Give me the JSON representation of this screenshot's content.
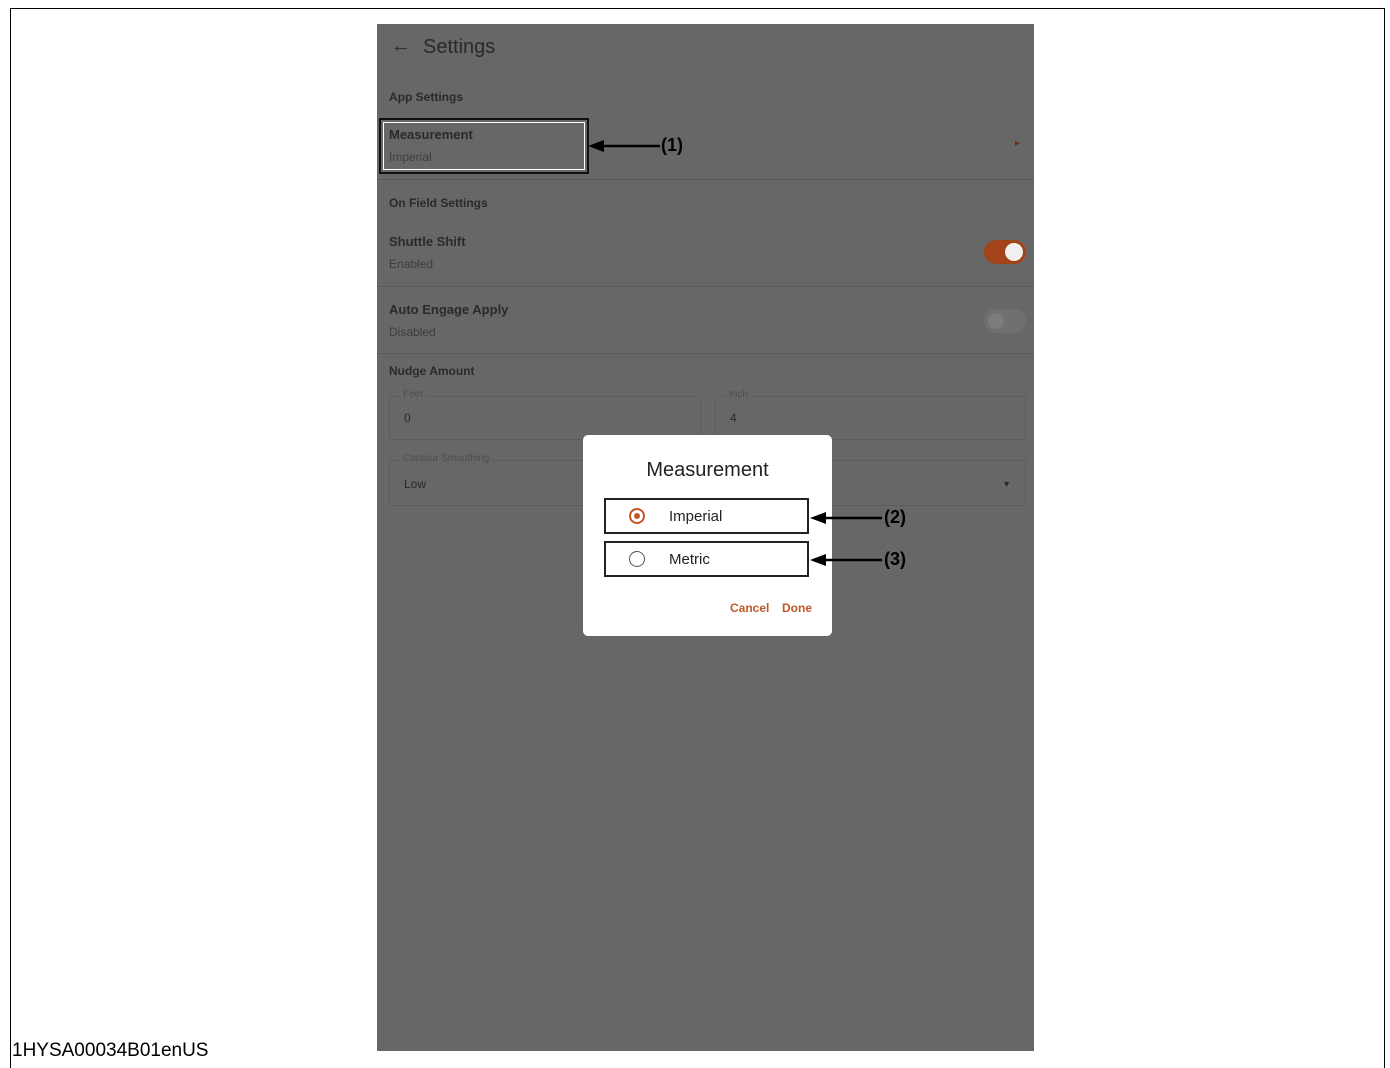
{
  "doc_id": "1HYSA00034B01enUS",
  "appbar": {
    "title": "Settings"
  },
  "sections": {
    "app": "App Settings",
    "field": "On Field Settings",
    "nudge": "Nudge Amount"
  },
  "rows": {
    "measurement": {
      "title": "Measurement",
      "value": "Imperial"
    },
    "shuttle": {
      "title": "Shuttle Shift",
      "value": "Enabled",
      "on": true
    },
    "auto_engage": {
      "title": "Auto Engage Apply",
      "value": "Disabled",
      "on": false
    }
  },
  "nudge": {
    "feet_label": "Feet",
    "feet_value": "0",
    "inch_label": "Inch",
    "inch_value": "4"
  },
  "contour": {
    "label": "Contour Smoothing",
    "value": "Low"
  },
  "dialog": {
    "title": "Measurement",
    "options": [
      {
        "label": "Imperial",
        "selected": true
      },
      {
        "label": "Metric",
        "selected": false
      }
    ],
    "cancel": "Cancel",
    "done": "Done"
  },
  "callouts": [
    "(1)",
    "(2)",
    "(3)"
  ],
  "colors": {
    "accent": "#c0582a",
    "overlay": "#676767",
    "toggle_on": "#a3431a"
  }
}
